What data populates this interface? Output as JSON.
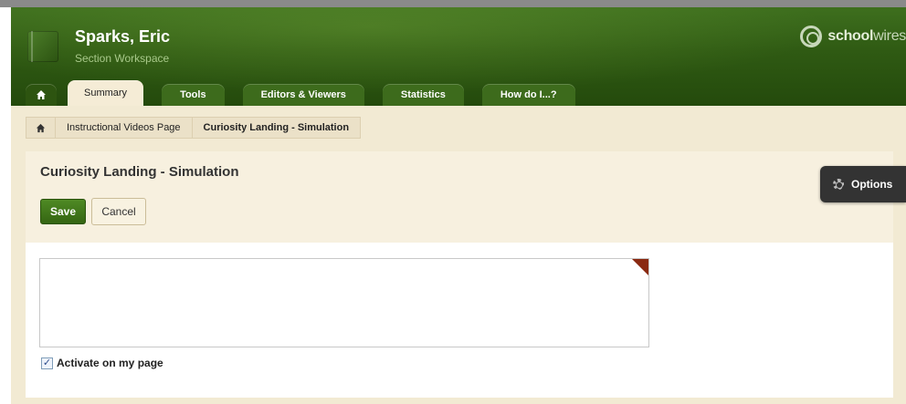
{
  "header": {
    "owner_name": "Sparks, Eric",
    "workspace_label": "Section Workspace",
    "logo_bold": "school",
    "logo_light": "wires"
  },
  "tabs": [
    {
      "label": "Summary",
      "active": true
    },
    {
      "label": "Tools",
      "active": false
    },
    {
      "label": "Editors & Viewers",
      "active": false
    },
    {
      "label": "Statistics",
      "active": false
    },
    {
      "label": "How do I...?",
      "active": false
    }
  ],
  "breadcrumb": {
    "items": [
      "Instructional Videos Page",
      "Curiosity Landing - Simulation"
    ]
  },
  "editor": {
    "title": "Curiosity Landing - Simulation",
    "save_label": "Save",
    "cancel_label": "Cancel",
    "activate_label": "Activate on my page",
    "activate_checked": true
  },
  "options": {
    "label": "Options"
  },
  "colors": {
    "header_green": "#2f5a13",
    "tab_green": "#3d6b1c",
    "content_beige": "#f2ead3",
    "save_green": "#4f8a24",
    "options_dark": "#333333"
  }
}
